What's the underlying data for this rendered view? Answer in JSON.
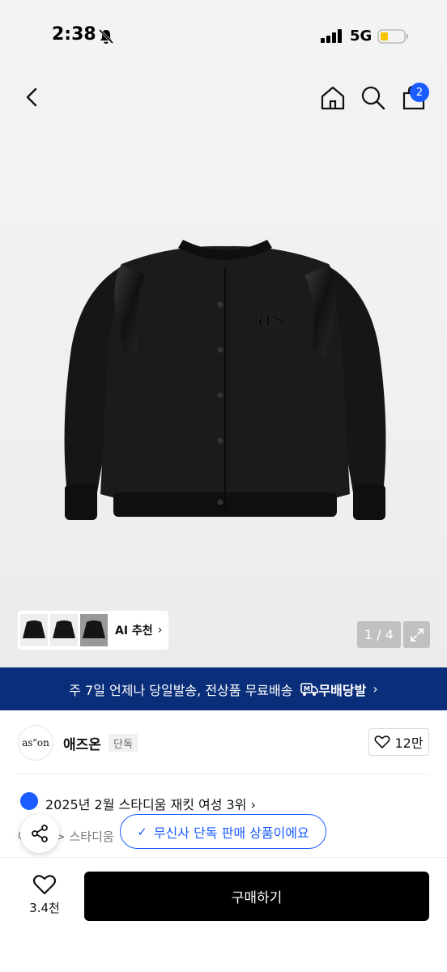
{
  "status_bar": {
    "time": "2:38",
    "network": "5G"
  },
  "nav": {
    "cart_count": "2"
  },
  "gallery": {
    "ai_label": "AI 추천",
    "pager": "1 / 4"
  },
  "banner": {
    "text": "주 7일 언제나 당일발송, 전상품 무료배송",
    "badge_label": "무배당발"
  },
  "brand": {
    "logo_text": "as\"on",
    "name": "애즈온",
    "tag": "단독",
    "likes": "12만"
  },
  "ranking": {
    "text": "2025년 2월 스타디움 재킷 여성 3위"
  },
  "breadcrumb": {
    "text": "아우터 > 스타디움"
  },
  "exclusive_notice": "무신사 단독 판매 상품이에요",
  "bottom": {
    "wish_count": "3.4천",
    "buy_label": "구매하기"
  },
  "colors": {
    "accent": "#1a5cff",
    "banner": "#0a2e7a",
    "buy": "#000000"
  }
}
